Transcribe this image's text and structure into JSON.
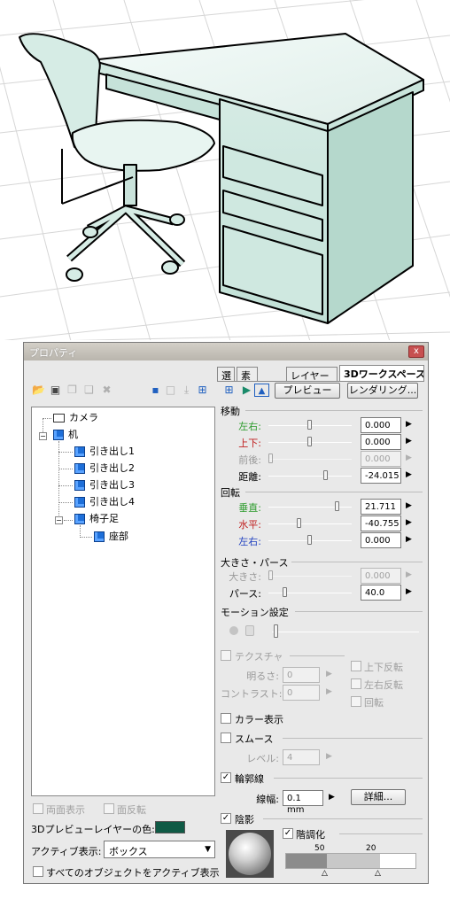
{
  "window": {
    "title": "プロパティ",
    "close_label": "x"
  },
  "tabs": [
    {
      "label": "選"
    },
    {
      "label": "素"
    },
    {
      "label": "レイヤー"
    },
    {
      "label": "3Dワークスペース",
      "active": true
    }
  ],
  "toolbar": {
    "preview_label": "プレビュー",
    "render_label": "レンダリング..."
  },
  "tree": {
    "nodes": [
      {
        "label": "カメラ"
      },
      {
        "label": "机"
      },
      {
        "label": "引き出し1"
      },
      {
        "label": "引き出し2"
      },
      {
        "label": "引き出し3"
      },
      {
        "label": "引き出し4"
      },
      {
        "label": "椅子足"
      },
      {
        "label": "座部"
      }
    ]
  },
  "move": {
    "header": "移動",
    "lr_label": "左右:",
    "lr_value": "0.000",
    "lr_color": "#2a9a2a",
    "ud_label": "上下:",
    "ud_value": "0.000",
    "ud_color": "#c02020",
    "fb_label": "前後:",
    "fb_value": "0.000",
    "dist_label": "距離:",
    "dist_value": "-24.015"
  },
  "rotate": {
    "header": "回転",
    "v_label": "垂直:",
    "v_value": "21.711",
    "v_color": "#2a9a2a",
    "h_label": "水平:",
    "h_value": "-40.755",
    "h_color": "#c02020",
    "lr_label": "左右:",
    "lr_value": "0.000",
    "lr_color": "#2040c0"
  },
  "size": {
    "header": "大きさ・パース",
    "size_label": "大きさ:",
    "size_value": "0.000",
    "pers_label": "パース:",
    "pers_value": "40.0"
  },
  "motion": {
    "header": "モーション設定"
  },
  "texture": {
    "header": "テクスチャ",
    "checked": false,
    "bright_label": "明るさ:",
    "bright_value": "0",
    "contrast_label": "コントラスト:",
    "contrast_value": "0",
    "flip_v": "上下反転",
    "flip_h": "左右反転",
    "rotate": "回転"
  },
  "color_display": {
    "label": "カラー表示",
    "checked": false
  },
  "smooth": {
    "label": "スムース",
    "checked": false,
    "level_label": "レベル:",
    "level_value": "4"
  },
  "outline": {
    "label": "輪郭線",
    "checked": true,
    "width_label": "線幅:",
    "width_value": "0.1 mm",
    "detail_label": "詳細..."
  },
  "shadow": {
    "label": "陰影",
    "checked": true,
    "gradation_label": "階調化",
    "gradation_checked": true,
    "mark1": "50",
    "mark2": "20",
    "tone_dark": "#8c8c8c",
    "tone_mid": "#c8c8c8",
    "tone_light": "#ffffff"
  },
  "bottom": {
    "backface_label": "両面表示",
    "flip_label": "面反転",
    "layer_color_label": "3Dプレビューレイヤーの色:",
    "layer_color": "#0f5a45",
    "active_label": "アクティブ表示:",
    "active_value": "ボックス",
    "all_active_label": "すべてのオブジェクトをアクティブ表示"
  }
}
